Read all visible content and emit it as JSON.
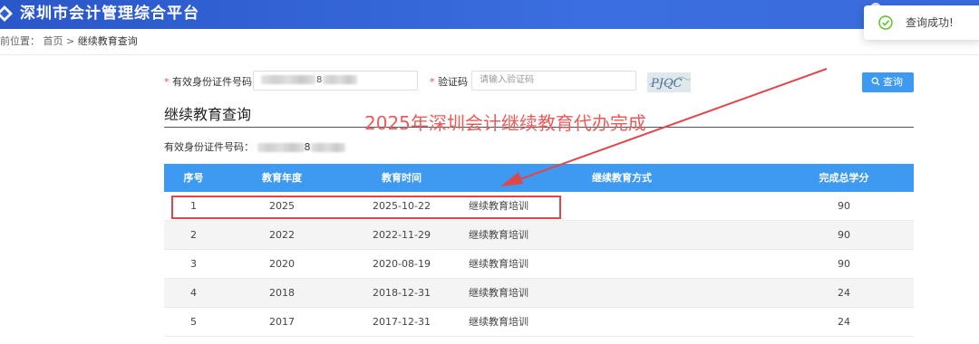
{
  "header": {
    "site_title": "深圳市会计管理综合平台"
  },
  "breadcrumb": {
    "prefix": "前位置：",
    "home": "首页",
    "separator": ">",
    "current": "继续教育查询"
  },
  "toast": {
    "icon": "check-circle-icon",
    "message": "查询成功!"
  },
  "form": {
    "id_label": "有效身份证件号码",
    "id_value_visible": "8",
    "captcha_label": "验证码",
    "captcha_placeholder": "请输入验证码",
    "captcha_image_text": "PJQC",
    "query_button": "查询"
  },
  "section": {
    "title": "继续教育查询",
    "id_prefix": "有效身份证件号码：",
    "id_value_visible": "8"
  },
  "annotation": {
    "text": "2025年深圳会计继续教育代办完成",
    "color": "#ee5a5a"
  },
  "table": {
    "headers": [
      "序号",
      "教育年度",
      "教育时间",
      "继续教育方式",
      "完成总学分"
    ],
    "rows": [
      {
        "no": "1",
        "year": "2025",
        "date": "2025-10-22",
        "method": "继续教育培训",
        "credits": "90"
      },
      {
        "no": "2",
        "year": "2022",
        "date": "2022-11-29",
        "method": "继续教育培训",
        "credits": "90"
      },
      {
        "no": "3",
        "year": "2020",
        "date": "2020-08-19",
        "method": "继续教育培训",
        "credits": "90"
      },
      {
        "no": "4",
        "year": "2018",
        "date": "2018-12-31",
        "method": "继续教育培训",
        "credits": "24"
      },
      {
        "no": "5",
        "year": "2017",
        "date": "2017-12-31",
        "method": "继续教育培训",
        "credits": "24"
      }
    ]
  },
  "colors": {
    "header_bg": "#2f5fd0",
    "table_header_bg": "#3d9af0",
    "button_bg": "#3d9af0",
    "required_mark": "#f04b4b",
    "highlight_border": "#e0474c",
    "success": "#52c41a"
  }
}
